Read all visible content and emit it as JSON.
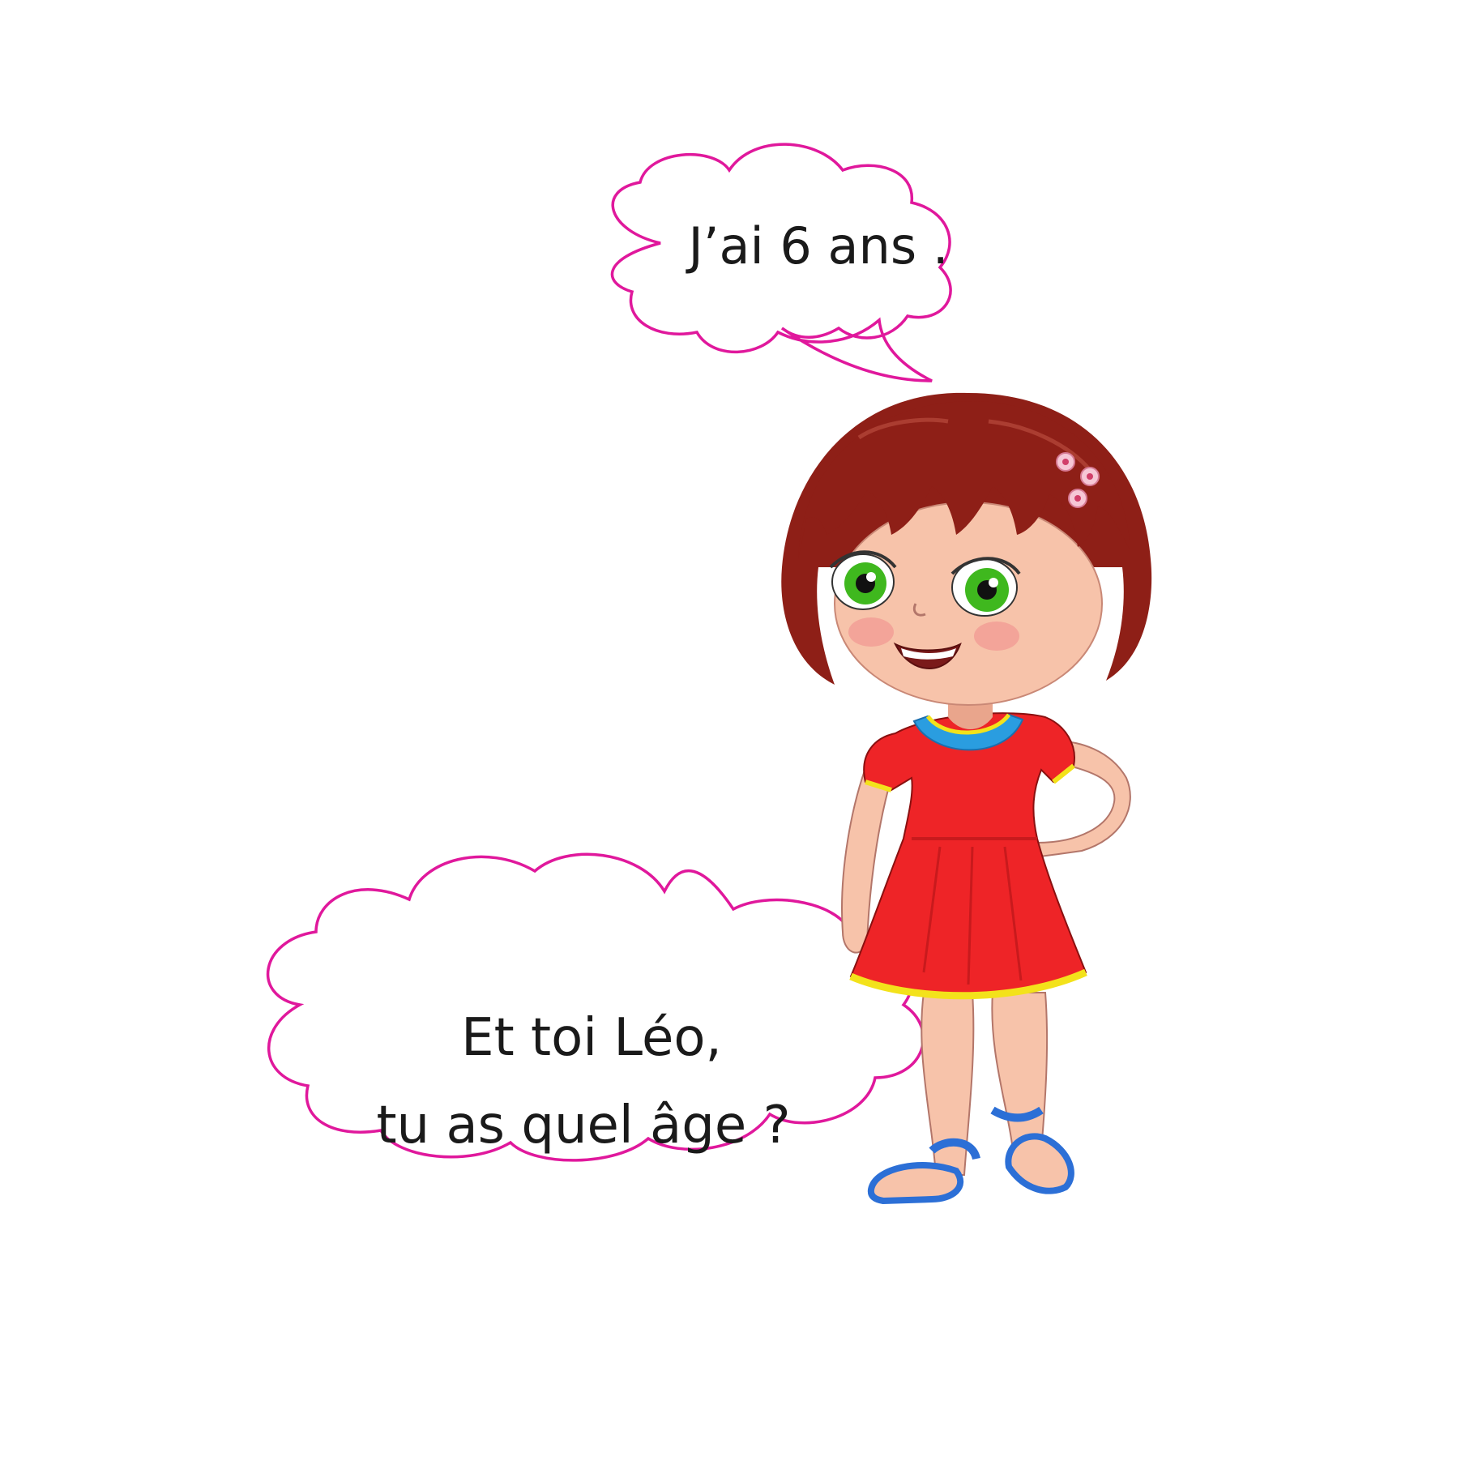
{
  "bubbles": {
    "top": {
      "text": "J’ai 6 ans ."
    },
    "bottom": {
      "line1": "Et toi Léo,",
      "line2": "tu as quel âge ?"
    }
  },
  "colors": {
    "bubble_outline": "#e0189c",
    "hair": "#8e1f17",
    "hair_dark": "#5e120c",
    "skin": "#f7c3aa",
    "skin_shadow": "#e9a58c",
    "eyes": "#3fb81e",
    "dress": "#ee2427",
    "dress_shadow": "#c81a1d",
    "collar": "#2a9de0",
    "trim": "#f3e21b",
    "sandals": "#2c6fd6"
  },
  "icons": [
    "speech-bubble",
    "girl-illustration"
  ]
}
